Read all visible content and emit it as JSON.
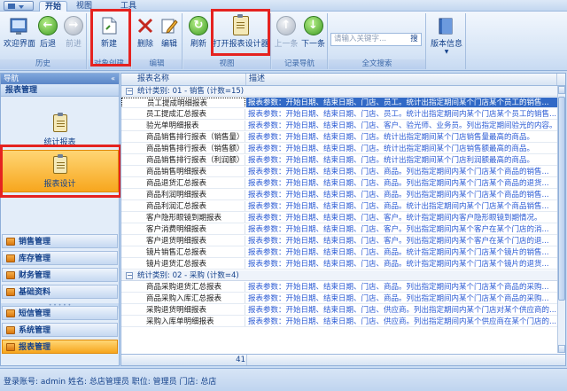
{
  "tabs": [
    "开始",
    "视图",
    "工具"
  ],
  "ribbon": {
    "groups": [
      {
        "label": "历史",
        "buttons": [
          "欢迎界面",
          "后退",
          "前进"
        ]
      },
      {
        "label": "对象创建",
        "buttons": [
          "新建"
        ]
      },
      {
        "label": "编辑",
        "buttons": [
          "删除",
          "编辑"
        ]
      },
      {
        "label": "视图",
        "buttons": [
          "刷新",
          "打开报表设计器"
        ]
      },
      {
        "label": "记录导航",
        "buttons": [
          "上一条",
          "下一条"
        ]
      },
      {
        "label": "全文搜索",
        "buttons": [
          "搜"
        ]
      },
      {
        "label": "",
        "buttons": [
          "版本信息"
        ]
      }
    ],
    "search_placeholder": "请输入关键字..."
  },
  "nav": {
    "header": "导航",
    "section": "报表管理",
    "big_items": [
      "统计报表",
      "报表设计"
    ],
    "items": [
      "销售管理",
      "库存管理",
      "财务管理",
      "基础资料",
      "短信管理",
      "系统管理",
      "报表管理"
    ]
  },
  "grid": {
    "columns": [
      "报表名称",
      "描述"
    ],
    "groups": [
      {
        "title": "统计类别: 01 - 销售 (计数=15)",
        "rows": [
          {
            "name": "员工提成明细报表",
            "desc": "报表参数：开始日期、结束日期、门店、员工。统计出指定期间某个门店某个员工的销售..."
          },
          {
            "name": "员工提成汇总报表",
            "desc": "报表参数：开始日期、结束日期、门店、员工。统计出指定期间内某个门店某个员工的销售..."
          },
          {
            "name": "验光单明细报表",
            "desc": "报表参数：开始日期、结束日期、门店、客户、验光师、业务员。列出指定期间验光的内容。"
          },
          {
            "name": "商品销售排行报表（销售量）",
            "desc": "报表参数：开始日期、结束日期、门店。统计出指定期间某个门店销售量最高的商品。"
          },
          {
            "name": "商品销售排行报表（销售额）",
            "desc": "报表参数：开始日期、结束日期、门店。统计出指定期间某个门店销售额最高的商品。"
          },
          {
            "name": "商品销售排行报表（利润额）",
            "desc": "报表参数：开始日期、结束日期、门店。统计出指定期间某个门店利润额最高的商品。"
          },
          {
            "name": "商品销售明细报表",
            "desc": "报表参数：开始日期、结束日期、门店、商品。列出指定期间内某个门店某个商品的销售..."
          },
          {
            "name": "商品退货汇总报表",
            "desc": "报表参数：开始日期、结束日期、门店、商品。列出指定期间内某个门店某个商品的退货..."
          },
          {
            "name": "商品利润明细报表",
            "desc": "报表参数：开始日期、结束日期、门店、商品。列出指定期间内某个门店某个商品的销售..."
          },
          {
            "name": "商品利润汇总报表",
            "desc": "报表参数：开始日期、结束日期、门店、商品。统计出指定期间内某个门店某个商品销售..."
          },
          {
            "name": "客户隐形眼镜到期报表",
            "desc": "报表参数：开始日期、结束日期、门店、客户。统计指定期间内客户隐形眼镜到期情况。"
          },
          {
            "name": "客户消费明细报表",
            "desc": "报表参数：开始日期、结束日期、门店、客户。列出指定期间内某个客户在某个门店的消..."
          },
          {
            "name": "客户退货明细报表",
            "desc": "报表参数：开始日期、结束日期、门店、客户。列出指定期间内某个客户在某个门店的退..."
          },
          {
            "name": "镜片销售汇总报表",
            "desc": "报表参数：开始日期、结束日期、门店、商品。统计指定期间内某个门店某个镜片的销售..."
          },
          {
            "name": "镜片退货汇总报表",
            "desc": "报表参数：开始日期、结束日期、门店、商品。统计指定期间内某个门店某个镜片的退货..."
          }
        ]
      },
      {
        "title": "统计类别: 02 - 采购 (计数=4)",
        "rows": [
          {
            "name": "商品采购退货汇总报表",
            "desc": "报表参数：开始日期、结束日期、门店、商品。列出指定期间内某个门店某个商品的采购..."
          },
          {
            "name": "商品采购入库汇总报表",
            "desc": "报表参数：开始日期、结束日期、门店、商品。列出指定期间内某个门店某个商品的采购..."
          },
          {
            "name": "采购退货明细报表",
            "desc": "报表参数：开始日期、结束日期、门店、供应商。列出指定期间内某个门店对某个供应商的..."
          },
          {
            "name": "采购入库单明细报表",
            "desc": "报表参数：开始日期、结束日期、门店、供应商。列出指定期间内某个供应商在某个门店的..."
          }
        ]
      }
    ],
    "footer_count": "41"
  },
  "status": "登录账号: admin  姓名: 总店管理员  职位: 管理员  门店: 总店"
}
